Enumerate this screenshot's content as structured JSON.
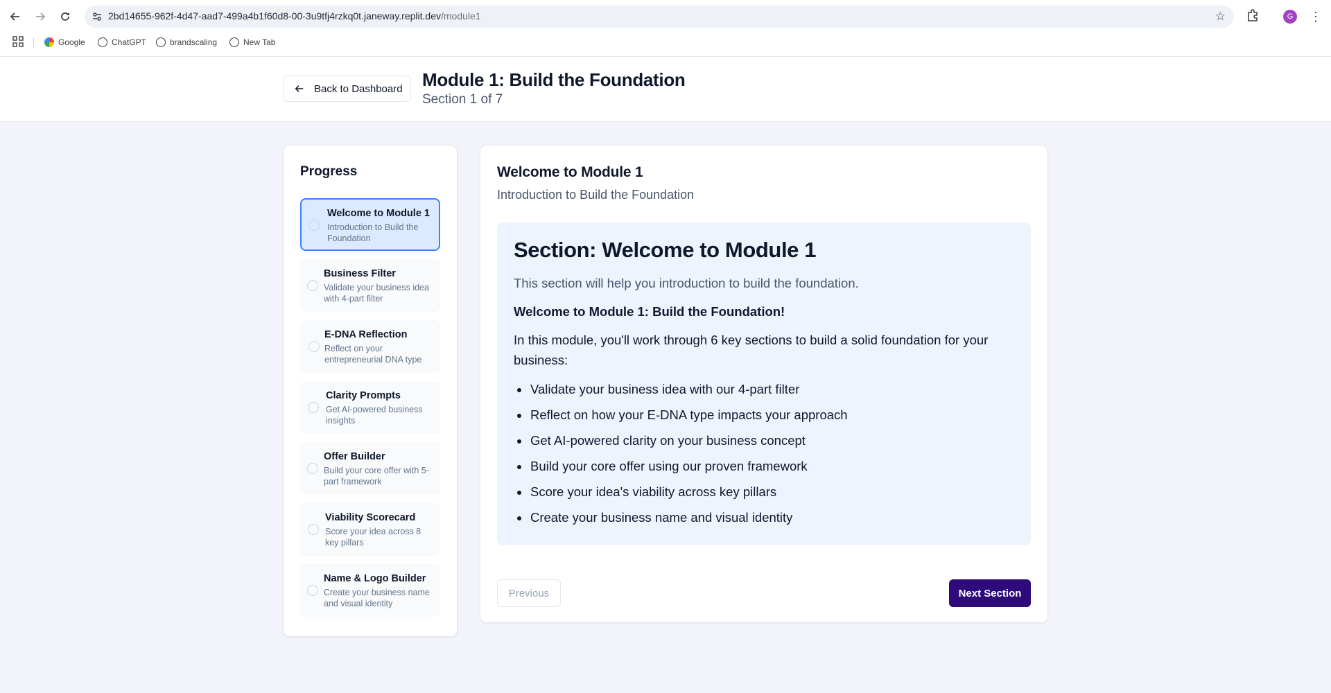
{
  "browser": {
    "url_host": "2bd14655-962f-4d47-aad7-499a4b1f60d8-00-3u9tfj4rzkq0t.janeway.replit.dev",
    "url_path": "/module1",
    "profile_initial": "G",
    "bookmarks": [
      {
        "label": "Google",
        "icon": "google-icon"
      },
      {
        "label": "ChatGPT",
        "icon": "chatgpt-icon"
      },
      {
        "label": "brandscaling",
        "icon": "globe-icon"
      },
      {
        "label": "New Tab",
        "icon": "globe-icon"
      }
    ]
  },
  "header": {
    "back_label": "Back to Dashboard",
    "title": "Module 1: Build the Foundation",
    "subtitle": "Section 1 of 7"
  },
  "progress": {
    "title": "Progress",
    "steps": [
      {
        "title": "Welcome to Module 1",
        "desc": "Introduction to Build the Foundation",
        "active": true
      },
      {
        "title": "Business Filter",
        "desc": "Validate your business idea with 4-part filter",
        "active": false
      },
      {
        "title": "E-DNA Reflection",
        "desc": "Reflect on your entrepreneurial DNA type",
        "active": false
      },
      {
        "title": "Clarity Prompts",
        "desc": "Get AI-powered business insights",
        "active": false
      },
      {
        "title": "Offer Builder",
        "desc": "Build your core offer with 5-part framework",
        "active": false
      },
      {
        "title": "Viability Scorecard",
        "desc": "Score your idea across 8 key pillars",
        "active": false
      },
      {
        "title": "Name & Logo Builder",
        "desc": "Create your business name and visual identity",
        "active": false
      }
    ]
  },
  "main": {
    "title": "Welcome to Module 1",
    "subtitle": "Introduction to Build the Foundation",
    "section_heading": "Section: Welcome to Module 1",
    "section_desc": "This section will help you introduction to build the foundation.",
    "welcome_line": "Welcome to Module 1: Build the Foundation!",
    "intro": "In this module, you'll work through 6 key sections to build a solid foundation for your business:",
    "bullets": [
      "Validate your business idea with our 4-part filter",
      "Reflect on how your E-DNA type impacts your approach",
      "Get AI-powered clarity on your business concept",
      "Build your core offer using our proven framework",
      "Score your idea's viability across key pillars",
      "Create your business name and visual identity"
    ],
    "prev_label": "Previous",
    "next_label": "Next Section"
  },
  "colors": {
    "accent": "#2e0a7a",
    "active_step_bg": "#dbeafe",
    "active_step_border": "#3b82f6",
    "content_bg": "#eef4fe"
  }
}
